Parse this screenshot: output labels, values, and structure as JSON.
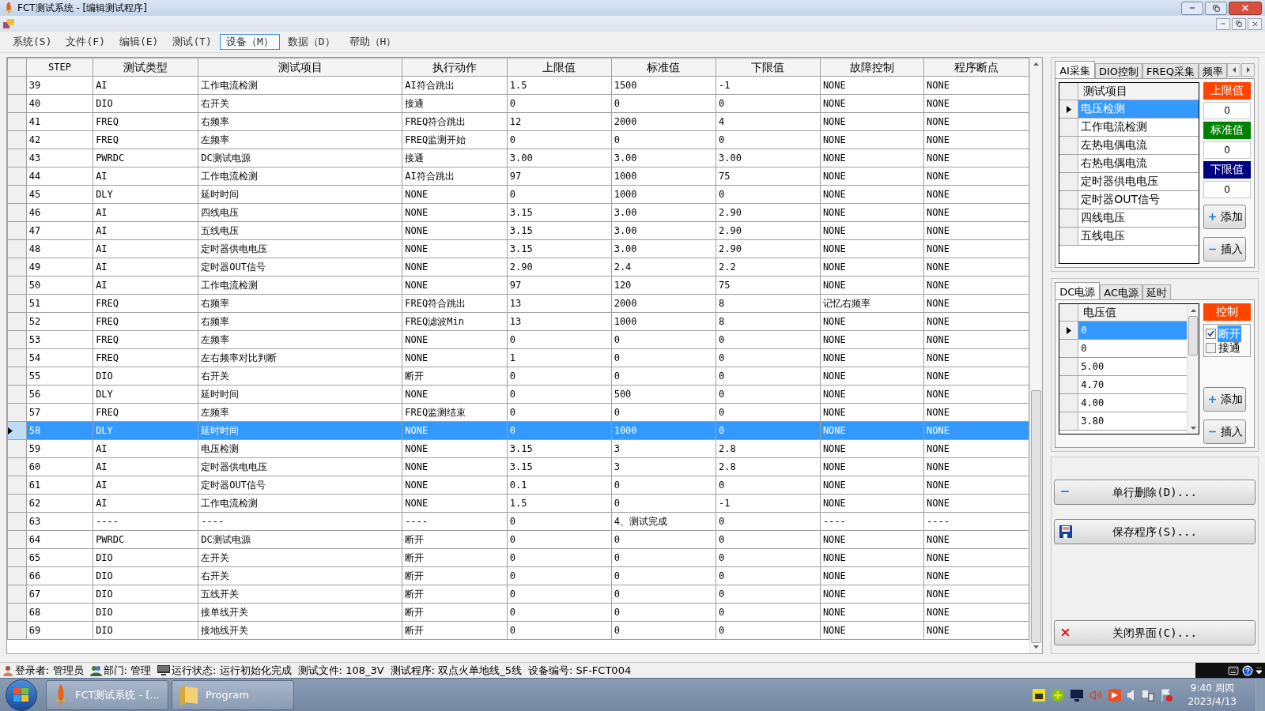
{
  "window": {
    "title": "FCT测试系统 - [编辑测试程序]"
  },
  "menu": [
    {
      "label": "系统(S)",
      "selected": false
    },
    {
      "label": "文件(F)",
      "selected": false
    },
    {
      "label": "编辑(E)",
      "selected": false
    },
    {
      "label": "测试(T)",
      "selected": false
    },
    {
      "label": "设备（M）",
      "selected": true
    },
    {
      "label": "数据（D）",
      "selected": false
    },
    {
      "label": "帮助（H）",
      "selected": false
    }
  ],
  "table": {
    "columns": [
      "STEP",
      "测试类型",
      "测试项目",
      "执行动作",
      "上限值",
      "标准值",
      "下限值",
      "故障控制",
      "程序断点"
    ],
    "rows": [
      {
        "cells": [
          "39",
          "AI",
          "工作电流检测",
          "AI符合跳出",
          "1.5",
          "1500",
          "-1",
          "NONE",
          "NONE"
        ],
        "selected": false
      },
      {
        "cells": [
          "40",
          "DIO",
          "右开关",
          "接通",
          "0",
          "0",
          "0",
          "NONE",
          "NONE"
        ],
        "selected": false
      },
      {
        "cells": [
          "41",
          "FREQ",
          "右频率",
          "FREQ符合跳出",
          "12",
          "2000",
          "4",
          "NONE",
          "NONE"
        ],
        "selected": false
      },
      {
        "cells": [
          "42",
          "FREQ",
          "左频率",
          "FREQ监测开始",
          "0",
          "0",
          "0",
          "NONE",
          "NONE"
        ],
        "selected": false
      },
      {
        "cells": [
          "43",
          "PWRDC",
          "DC测试电源",
          "接通",
          "3.00",
          "3.00",
          "3.00",
          "NONE",
          "NONE"
        ],
        "selected": false
      },
      {
        "cells": [
          "44",
          "AI",
          "工作电流检测",
          "AI符合跳出",
          "97",
          "1000",
          "75",
          "NONE",
          "NONE"
        ],
        "selected": false
      },
      {
        "cells": [
          "45",
          "DLY",
          "延时时间",
          "NONE",
          "0",
          "1000",
          "0",
          "NONE",
          "NONE"
        ],
        "selected": false
      },
      {
        "cells": [
          "46",
          "AI",
          "四线电压",
          "NONE",
          "3.15",
          "3.00",
          "2.90",
          "NONE",
          "NONE"
        ],
        "selected": false
      },
      {
        "cells": [
          "47",
          "AI",
          "五线电压",
          "NONE",
          "3.15",
          "3.00",
          "2.90",
          "NONE",
          "NONE"
        ],
        "selected": false
      },
      {
        "cells": [
          "48",
          "AI",
          "定时器供电电压",
          "NONE",
          "3.15",
          "3.00",
          "2.90",
          "NONE",
          "NONE"
        ],
        "selected": false
      },
      {
        "cells": [
          "49",
          "AI",
          "定时器OUT信号",
          "NONE",
          "2.90",
          "2.4",
          "2.2",
          "NONE",
          "NONE"
        ],
        "selected": false
      },
      {
        "cells": [
          "50",
          "AI",
          "工作电流检测",
          "NONE",
          "97",
          "120",
          "75",
          "NONE",
          "NONE"
        ],
        "selected": false
      },
      {
        "cells": [
          "51",
          "FREQ",
          "右频率",
          "FREQ符合跳出",
          "13",
          "2000",
          "8",
          "记忆右频率",
          "NONE"
        ],
        "selected": false
      },
      {
        "cells": [
          "52",
          "FREQ",
          "右频率",
          "FREQ滤波Min",
          "13",
          "1000",
          "8",
          "NONE",
          "NONE"
        ],
        "selected": false
      },
      {
        "cells": [
          "53",
          "FREQ",
          "左频率",
          "NONE",
          "0",
          "0",
          "0",
          "NONE",
          "NONE"
        ],
        "selected": false
      },
      {
        "cells": [
          "54",
          "FREQ",
          "左右频率对比判断",
          "NONE",
          "1",
          "0",
          "0",
          "NONE",
          "NONE"
        ],
        "selected": false
      },
      {
        "cells": [
          "55",
          "DIO",
          "右开关",
          "断开",
          "0",
          "0",
          "0",
          "NONE",
          "NONE"
        ],
        "selected": false
      },
      {
        "cells": [
          "56",
          "DLY",
          "延时时间",
          "NONE",
          "0",
          "500",
          "0",
          "NONE",
          "NONE"
        ],
        "selected": false
      },
      {
        "cells": [
          "57",
          "FREQ",
          "左频率",
          "FREQ监测结束",
          "0",
          "0",
          "0",
          "NONE",
          "NONE"
        ],
        "selected": false
      },
      {
        "cells": [
          "58",
          "DLY",
          "延时时间",
          "NONE",
          "0",
          "1000",
          "0",
          "NONE",
          "NONE"
        ],
        "selected": true
      },
      {
        "cells": [
          "59",
          "AI",
          "电压检测",
          "NONE",
          "3.15",
          "3",
          "2.8",
          "NONE",
          "NONE"
        ],
        "selected": false
      },
      {
        "cells": [
          "60",
          "AI",
          "定时器供电电压",
          "NONE",
          "3.15",
          "3",
          "2.8",
          "NONE",
          "NONE"
        ],
        "selected": false
      },
      {
        "cells": [
          "61",
          "AI",
          "定时器OUT信号",
          "NONE",
          "0.1",
          "0",
          "0",
          "NONE",
          "NONE"
        ],
        "selected": false
      },
      {
        "cells": [
          "62",
          "AI",
          "工作电流检测",
          "NONE",
          "1.5",
          "0",
          "-1",
          "NONE",
          "NONE"
        ],
        "selected": false
      },
      {
        "cells": [
          "63",
          "----",
          "----",
          "----",
          "0",
          "4、测试完成",
          "0",
          "----",
          "----"
        ],
        "selected": false
      },
      {
        "cells": [
          "64",
          "PWRDC",
          "DC测试电源",
          "断开",
          "0",
          "0",
          "0",
          "NONE",
          "NONE"
        ],
        "selected": false
      },
      {
        "cells": [
          "65",
          "DIO",
          "左开关",
          "断开",
          "0",
          "0",
          "0",
          "NONE",
          "NONE"
        ],
        "selected": false
      },
      {
        "cells": [
          "66",
          "DIO",
          "右开关",
          "断开",
          "0",
          "0",
          "0",
          "NONE",
          "NONE"
        ],
        "selected": false
      },
      {
        "cells": [
          "67",
          "DIO",
          "五线开关",
          "断开",
          "0",
          "0",
          "0",
          "NONE",
          "NONE"
        ],
        "selected": false
      },
      {
        "cells": [
          "68",
          "DIO",
          "接单线开关",
          "断开",
          "0",
          "0",
          "0",
          "NONE",
          "NONE"
        ],
        "selected": false
      },
      {
        "cells": [
          "69",
          "DIO",
          "接地线开关",
          "断开",
          "0",
          "0",
          "0",
          "NONE",
          "NONE"
        ],
        "selected": false
      }
    ]
  },
  "ai_panel": {
    "tabs": [
      {
        "label": "AI采集",
        "selected": true
      },
      {
        "label": "DIO控制",
        "selected": false
      },
      {
        "label": "FREQ采集",
        "selected": false
      },
      {
        "label": "频率",
        "selected": false
      }
    ],
    "list_header": "测试项目",
    "items": [
      {
        "label": "电压检测",
        "selected": true
      },
      {
        "label": "工作电流检测",
        "selected": false
      },
      {
        "label": "左热电偶电流",
        "selected": false
      },
      {
        "label": "右热电偶电流",
        "selected": false
      },
      {
        "label": "定时器供电电压",
        "selected": false
      },
      {
        "label": "定时器OUT信号",
        "selected": false
      },
      {
        "label": "四线电压",
        "selected": false
      },
      {
        "label": "五线电压",
        "selected": false
      }
    ],
    "limits": [
      {
        "label": "上限值",
        "color": "#ff4500",
        "value": "0"
      },
      {
        "label": "标准值",
        "color": "#008000",
        "value": "0"
      },
      {
        "label": "下限值",
        "color": "#000080",
        "value": "0"
      }
    ],
    "buttons": [
      {
        "kind": "add",
        "label": "添加"
      },
      {
        "kind": "insert",
        "label": "插入"
      }
    ]
  },
  "power_panel": {
    "tabs": [
      {
        "label": "DC电源",
        "selected": true
      },
      {
        "label": "AC电源",
        "selected": false
      },
      {
        "label": "延时",
        "selected": false
      }
    ],
    "list_header": "电压值",
    "items": [
      {
        "label": "0",
        "selected": true
      },
      {
        "label": "0",
        "selected": false
      },
      {
        "label": "5.00",
        "selected": false
      },
      {
        "label": "4.70",
        "selected": false
      },
      {
        "label": "4.00",
        "selected": false
      },
      {
        "label": "3.80",
        "selected": false
      }
    ],
    "control_label": "控制",
    "options": [
      {
        "label": "断开",
        "checked": true,
        "selected": true
      },
      {
        "label": "接通",
        "checked": false,
        "selected": false
      }
    ],
    "buttons": [
      {
        "kind": "add",
        "label": "添加"
      },
      {
        "kind": "insert",
        "label": "插入"
      }
    ]
  },
  "actions": [
    {
      "kind": "delete",
      "label": "单行删除(D)..."
    },
    {
      "kind": "save",
      "label": "保存程序(S)..."
    },
    {
      "kind": "close",
      "label": "关闭界面(C)..."
    }
  ],
  "status_bar": [
    {
      "kind": "user",
      "label": "登录者:",
      "value": "管理员"
    },
    {
      "kind": "dept",
      "label": "部门:",
      "value": "管理"
    },
    {
      "kind": "state",
      "label": "运行状态:",
      "value": "运行初始化完成"
    },
    {
      "kind": "text",
      "label": "测试文件:",
      "value": "108_3V"
    },
    {
      "kind": "text",
      "label": "测试程序:",
      "value": "双点火单地线_5线"
    },
    {
      "kind": "text",
      "label": "设备编号:",
      "value": "SF-FCT004"
    }
  ],
  "taskbar": {
    "items": [
      {
        "kind": "app",
        "label": "FCT测试系统 - [..."
      },
      {
        "kind": "folder",
        "label": "Program"
      }
    ],
    "time": "9:40 周四",
    "date": "2023/4/13"
  }
}
